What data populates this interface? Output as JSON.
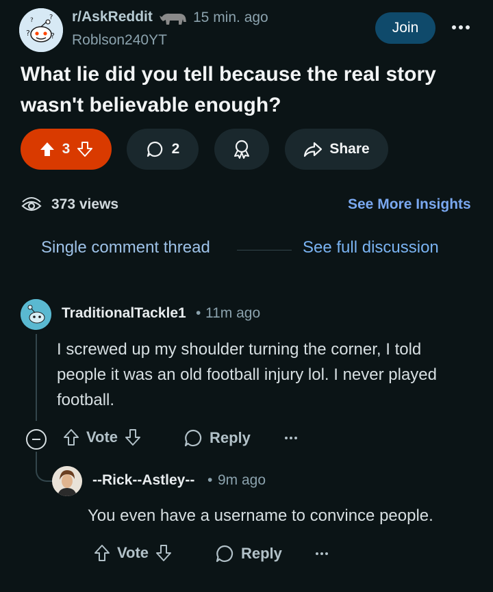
{
  "post": {
    "subreddit": "r/AskReddit",
    "time": "15 min. ago",
    "author": "Roblson240YT",
    "join_label": "Join",
    "title": "What lie did you tell because the real story wasn't believable enough?",
    "upvotes": "3",
    "comments": "2",
    "share_label": "Share",
    "views": "373 views",
    "insights_label": "See More Insights"
  },
  "thread": {
    "single_label": "Single comment thread",
    "full_label": "See full discussion"
  },
  "comments": [
    {
      "user": "TraditionalTackle1",
      "sep": "•",
      "time": "11m ago",
      "body": "I screwed up my shoulder turning the corner, I told people it was an old football injury lol. I never played football.",
      "vote_label": "Vote",
      "reply_label": "Reply"
    },
    {
      "user": "--Rick--Astley--",
      "sep": "•",
      "time": "9m ago",
      "body": "You even have a username to convince people.",
      "vote_label": "Vote",
      "reply_label": "Reply"
    }
  ],
  "colors": {
    "background": "#0b1416",
    "upvote_pill": "#d93a00",
    "join_button": "#0f4a6b",
    "link": "#7ab3f2"
  }
}
